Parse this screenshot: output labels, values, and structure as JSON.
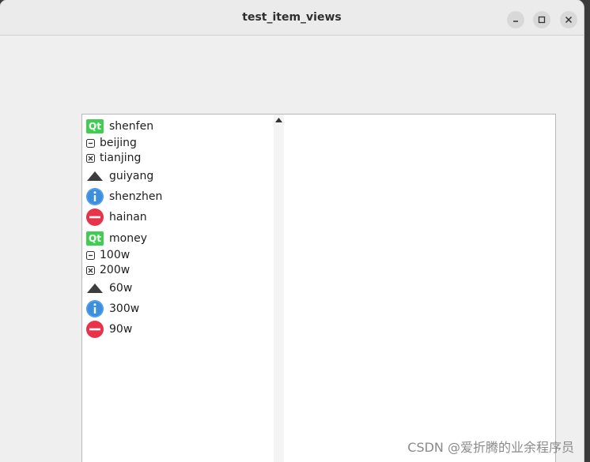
{
  "window": {
    "title": "test_item_views"
  },
  "tree": {
    "items": [
      {
        "label": "shenfen",
        "icon": "qt-logo-icon"
      },
      {
        "label": "beijing",
        "icon": "minus-box-icon"
      },
      {
        "label": "tianjing",
        "icon": "x-box-icon"
      },
      {
        "label": "guiyang",
        "icon": "up-triangle-icon"
      },
      {
        "label": "shenzhen",
        "icon": "info-icon"
      },
      {
        "label": "hainan",
        "icon": "no-entry-icon"
      },
      {
        "label": "money",
        "icon": "qt-logo-icon"
      },
      {
        "label": "100w",
        "icon": "minus-box-icon"
      },
      {
        "label": "200w",
        "icon": "x-box-icon"
      },
      {
        "label": "60w",
        "icon": "up-triangle-icon"
      },
      {
        "label": "300w",
        "icon": "info-icon"
      },
      {
        "label": "90w",
        "icon": "no-entry-icon"
      }
    ],
    "qt_badge": "Qt"
  },
  "watermark": "CSDN @爱折腾的业余程序员",
  "colors": {
    "qt": "#41cd52",
    "info": "#3b8fde",
    "no_entry": "#e8334a"
  }
}
